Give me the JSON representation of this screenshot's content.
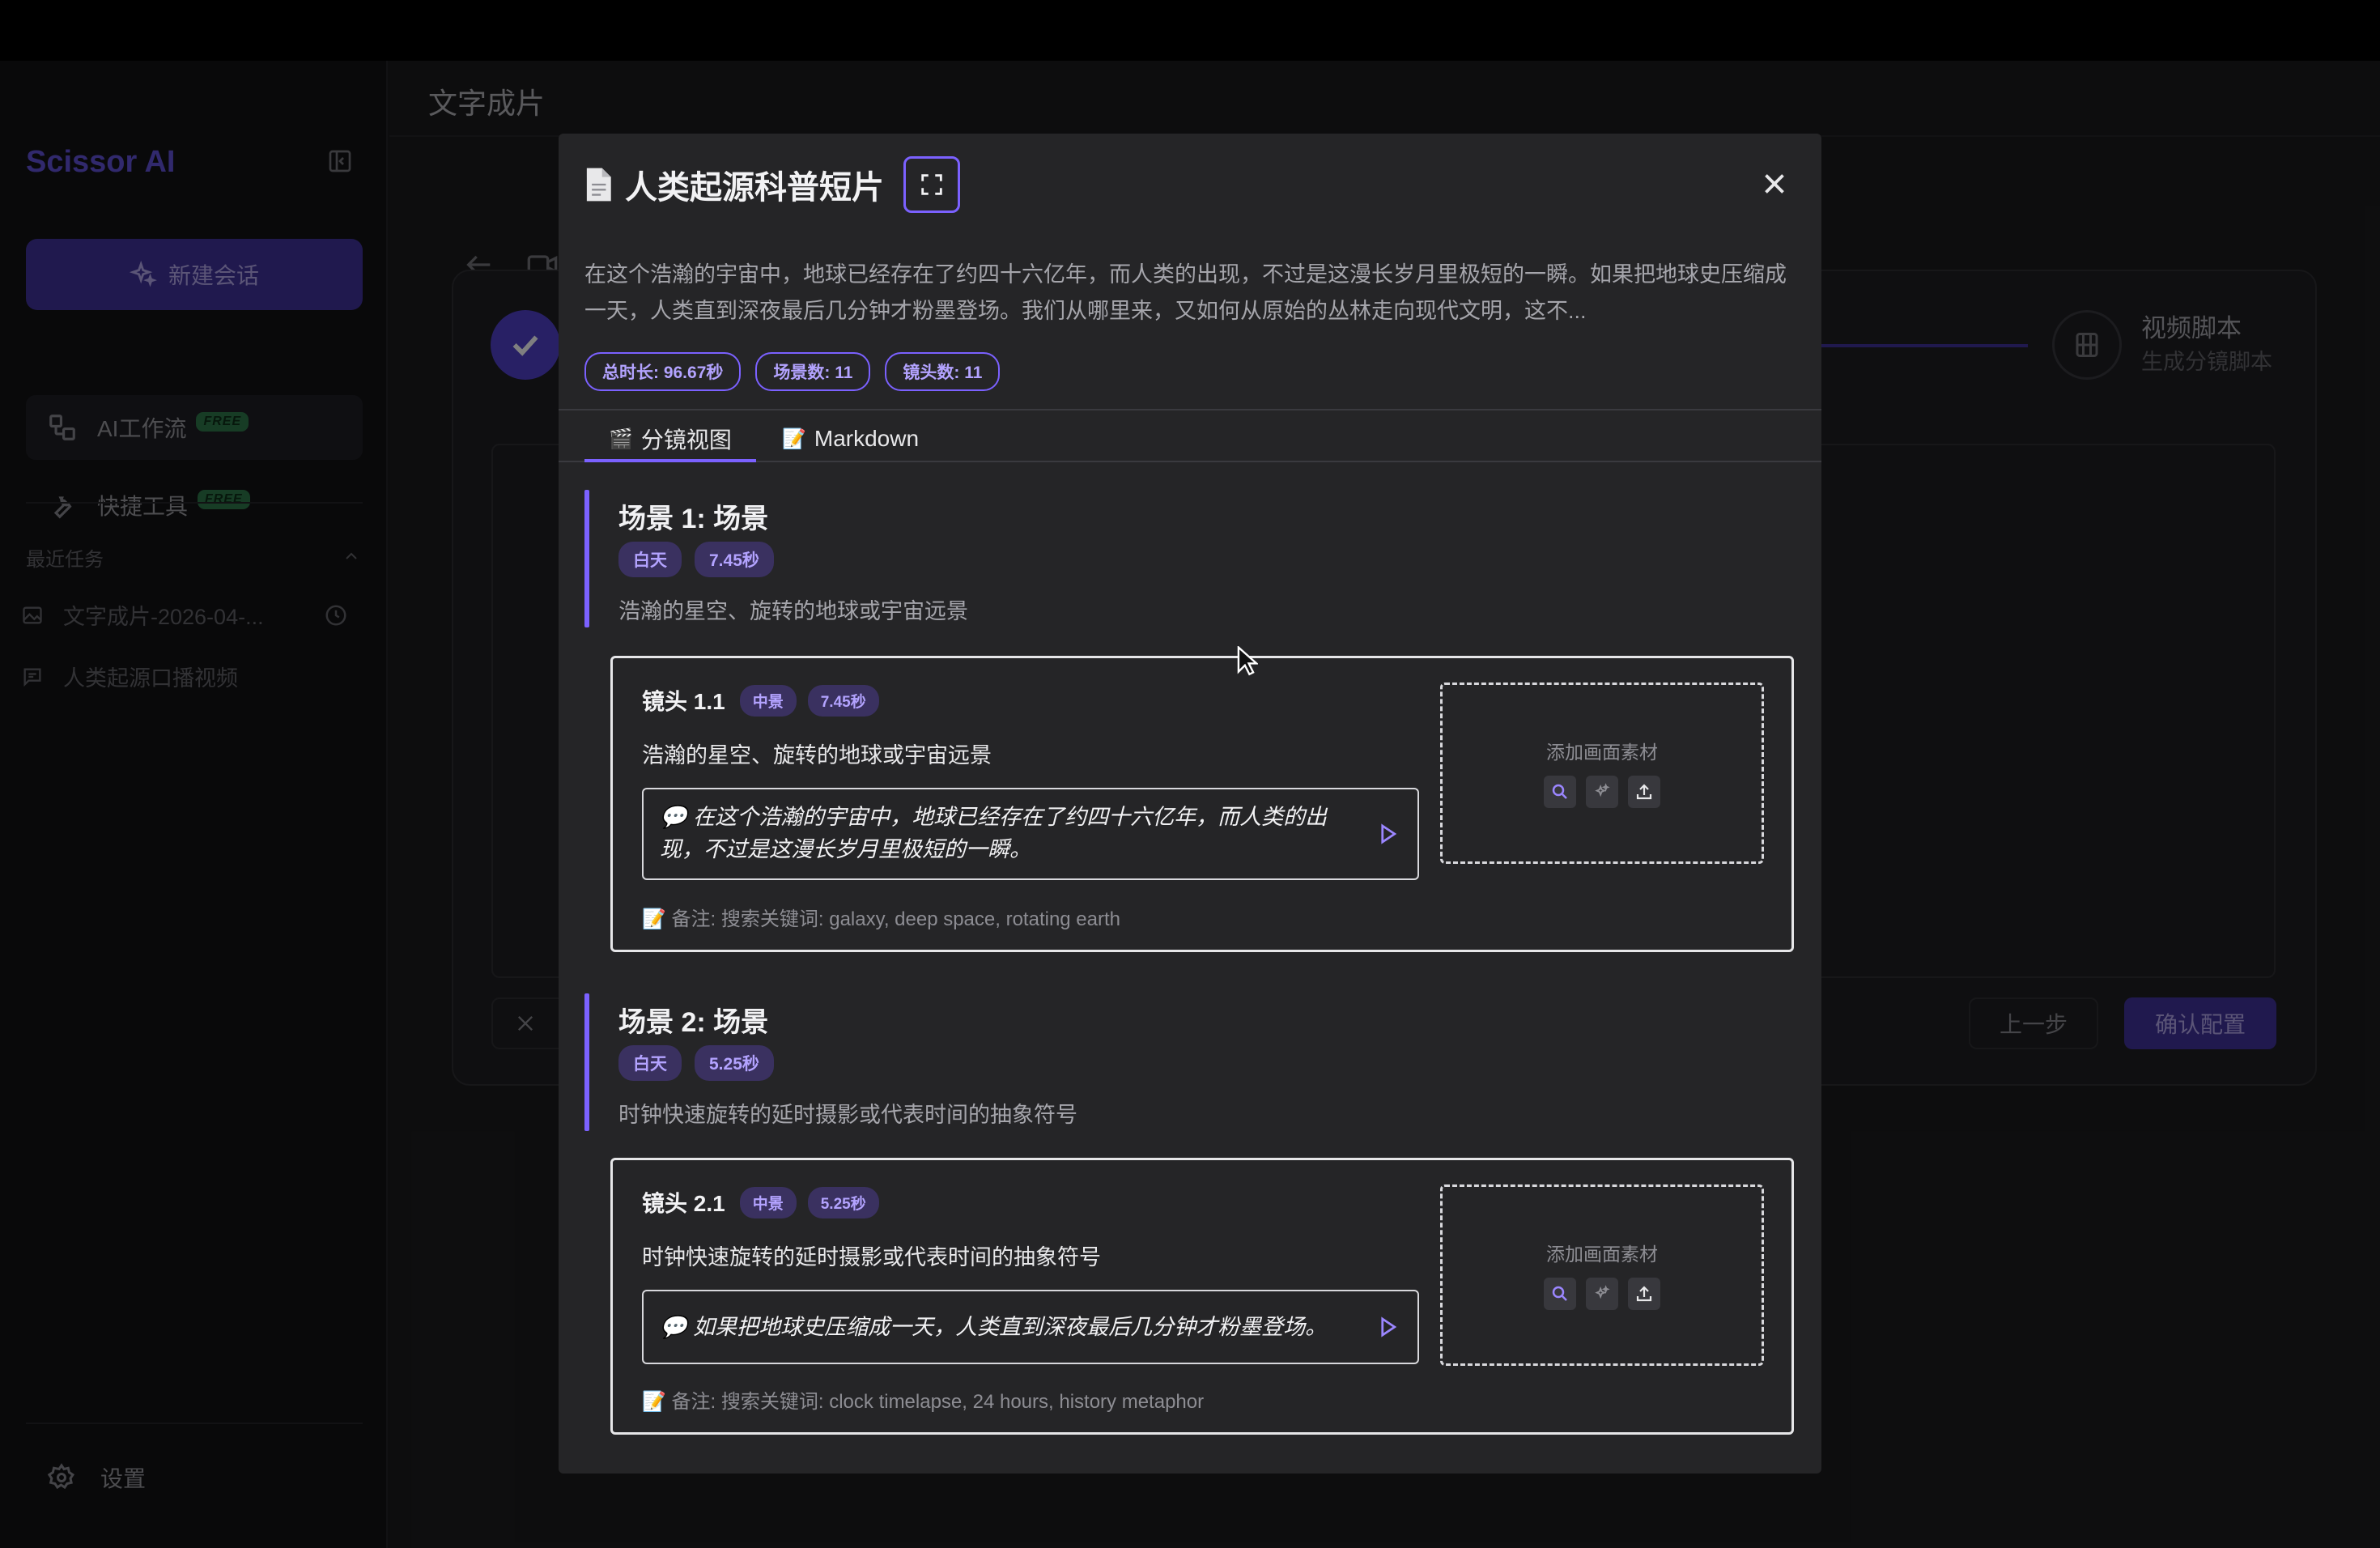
{
  "app": {
    "brand": "Scissor AI",
    "new_chat_label": "新建会话",
    "nav": [
      {
        "label": "AI工作流",
        "badge": "FREE"
      },
      {
        "label": "快捷工具",
        "badge": "FREE"
      }
    ],
    "recent_title": "最近任务",
    "recent_items": [
      {
        "label": "文字成片-2026-04-..."
      },
      {
        "label": "人类起源口播视频"
      }
    ],
    "settings_label": "设置",
    "page_title": "文字成片",
    "step": {
      "title": "视频脚本",
      "subtitle": "生成分镜脚本"
    },
    "prev_label": "上一步",
    "confirm_label": "确认配置"
  },
  "modal": {
    "title": "人类起源科普短片",
    "description": "在这个浩瀚的宇宙中，地球已经存在了约四十六亿年，而人类的出现，不过是这漫长岁月里极短的一瞬。如果把地球史压缩成一天，人类直到深夜最后几分钟才粉墨登场。我们从哪里来，又如何从原始的丛林走向现代文明，这不...",
    "stats": [
      "总时长: 96.67秒",
      "场景数: 11",
      "镜头数: 11"
    ],
    "tabs": [
      {
        "icon": "🎬",
        "label": "分镜视图"
      },
      {
        "icon": "📝",
        "label": "Markdown"
      }
    ],
    "scenes": [
      {
        "title": "场景 1: 场景",
        "time_of_day": "白天",
        "duration": "7.45秒",
        "description": "浩瀚的星空、旋转的地球或宇宙远景",
        "shot": {
          "label": "镜头 1.1",
          "type": "中景",
          "duration": "7.45秒",
          "description": "浩瀚的星空、旋转的地球或宇宙远景",
          "narration": "💬 在这个浩瀚的宇宙中，地球已经存在了约四十六亿年，而人类的出现，不过是这漫长岁月里极短的一瞬。",
          "note": "📝 备注: 搜索关键词: galaxy, deep space, rotating earth",
          "asset_label": "添加画面素材"
        }
      },
      {
        "title": "场景 2: 场景",
        "time_of_day": "白天",
        "duration": "5.25秒",
        "description": "时钟快速旋转的延时摄影或代表时间的抽象符号",
        "shot": {
          "label": "镜头 2.1",
          "type": "中景",
          "duration": "5.25秒",
          "description": "时钟快速旋转的延时摄影或代表时间的抽象符号",
          "narration": "💬 如果把地球史压缩成一天，人类直到深夜最后几分钟才粉墨登场。",
          "note": "📝 备注: 搜索关键词: clock timelapse, 24 hours, history metaphor",
          "asset_label": "添加画面素材"
        }
      }
    ]
  },
  "colors": {
    "accent": "#7b61ff",
    "modal_bg": "#252527",
    "tag_bg": "#3a3160"
  }
}
